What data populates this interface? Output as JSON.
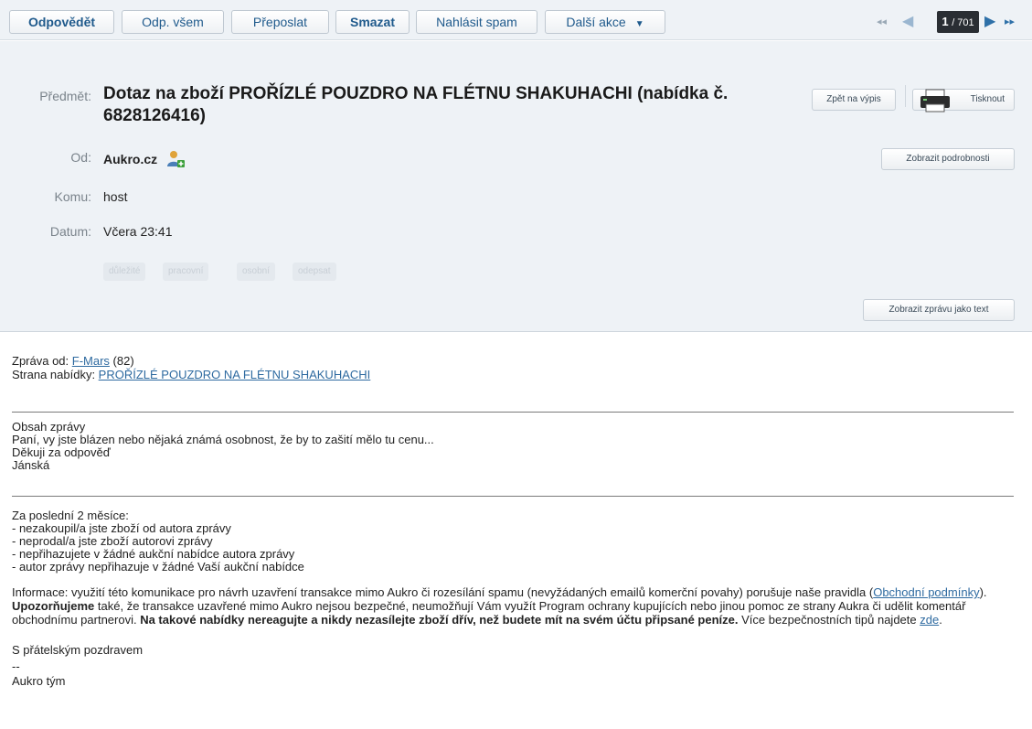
{
  "toolbar": {
    "reply": "Odpovědět",
    "reply_all": "Odp. všem",
    "forward": "Přeposlat",
    "delete": "Smazat",
    "report_spam": "Nahlásit spam",
    "more_actions": "Další akce",
    "pager": {
      "current": "1",
      "total": "/ 701"
    }
  },
  "header": {
    "subject_label": "Předmět:",
    "subject": "Dotaz na zboží PROŘÍZLÉ POUZDRO NA FLÉTNU SHAKUHACHI (nabídka č. 6828126416)",
    "back_to_list": "Zpět na výpis",
    "print": "Tisknout",
    "from_label": "Od:",
    "from": "Aukro.cz",
    "show_details": "Zobrazit podrobnosti",
    "to_label": "Komu:",
    "to": "host",
    "date_label": "Datum:",
    "date": "Včera 23:41",
    "tags": [
      "důležité",
      "pracovní",
      "osobní",
      "odepsat"
    ],
    "show_as_text": "Zobrazit zprávu jako text"
  },
  "message": {
    "from_prefix": "Zpráva od: ",
    "from_user": "F-Mars",
    "from_rating": " (82)",
    "offer_prefix": "Strana nabídky: ",
    "offer_link": "PROŘÍZLÉ POUZDRO NA FLÉTNU SHAKUHACHI",
    "content_heading": "Obsah zprávy",
    "content_lines": [
      "Paní, vy jste blázen nebo nějaká známá osobnost, že by to zašití mělo tu cenu...",
      "Děkuji za odpověď",
      "Jánská"
    ],
    "history_heading": "Za poslední 2 měsíce:",
    "history_lines": [
      "- nezakoupil/a jste zboží od autora zprávy",
      "- neprodal/a jste zboží autorovi zprávy",
      "- nepřihazujete v žádné aukční nabídce autora zprávy",
      "- autor zprávy nepřihazuje v žádné Vaší aukční nabídce"
    ],
    "info_1": "Informace: využití této komunikace pro návrh uzavření transakce mimo Aukro či rozesílání spamu (nevyžádaných emailů komerční povahy) porušuje naše pravidla (",
    "info_link": "Obchodní podmínky",
    "info_2": "). ",
    "info_bold_1": "Upozorňujeme",
    "info_3": " také, že transakce uzavřené mimo Aukro nejsou bezpečné, neumožňují Vám využít Program ochrany kupujících nebo jinou pomoc ze strany Aukra či udělit komentář obchodnímu partnerovi. ",
    "info_bold_2": "Na takové nabídky nereagujte a nikdy nezasílejte zboží dřív, než budete mít na svém účtu připsané peníze.",
    "info_4": " Více bezpečnostních tipů najdete ",
    "info_link_2": "zde",
    "info_5": ".",
    "greeting": "S přátelským pozdravem",
    "sig_sep": "--",
    "team": "Aukro tým"
  }
}
